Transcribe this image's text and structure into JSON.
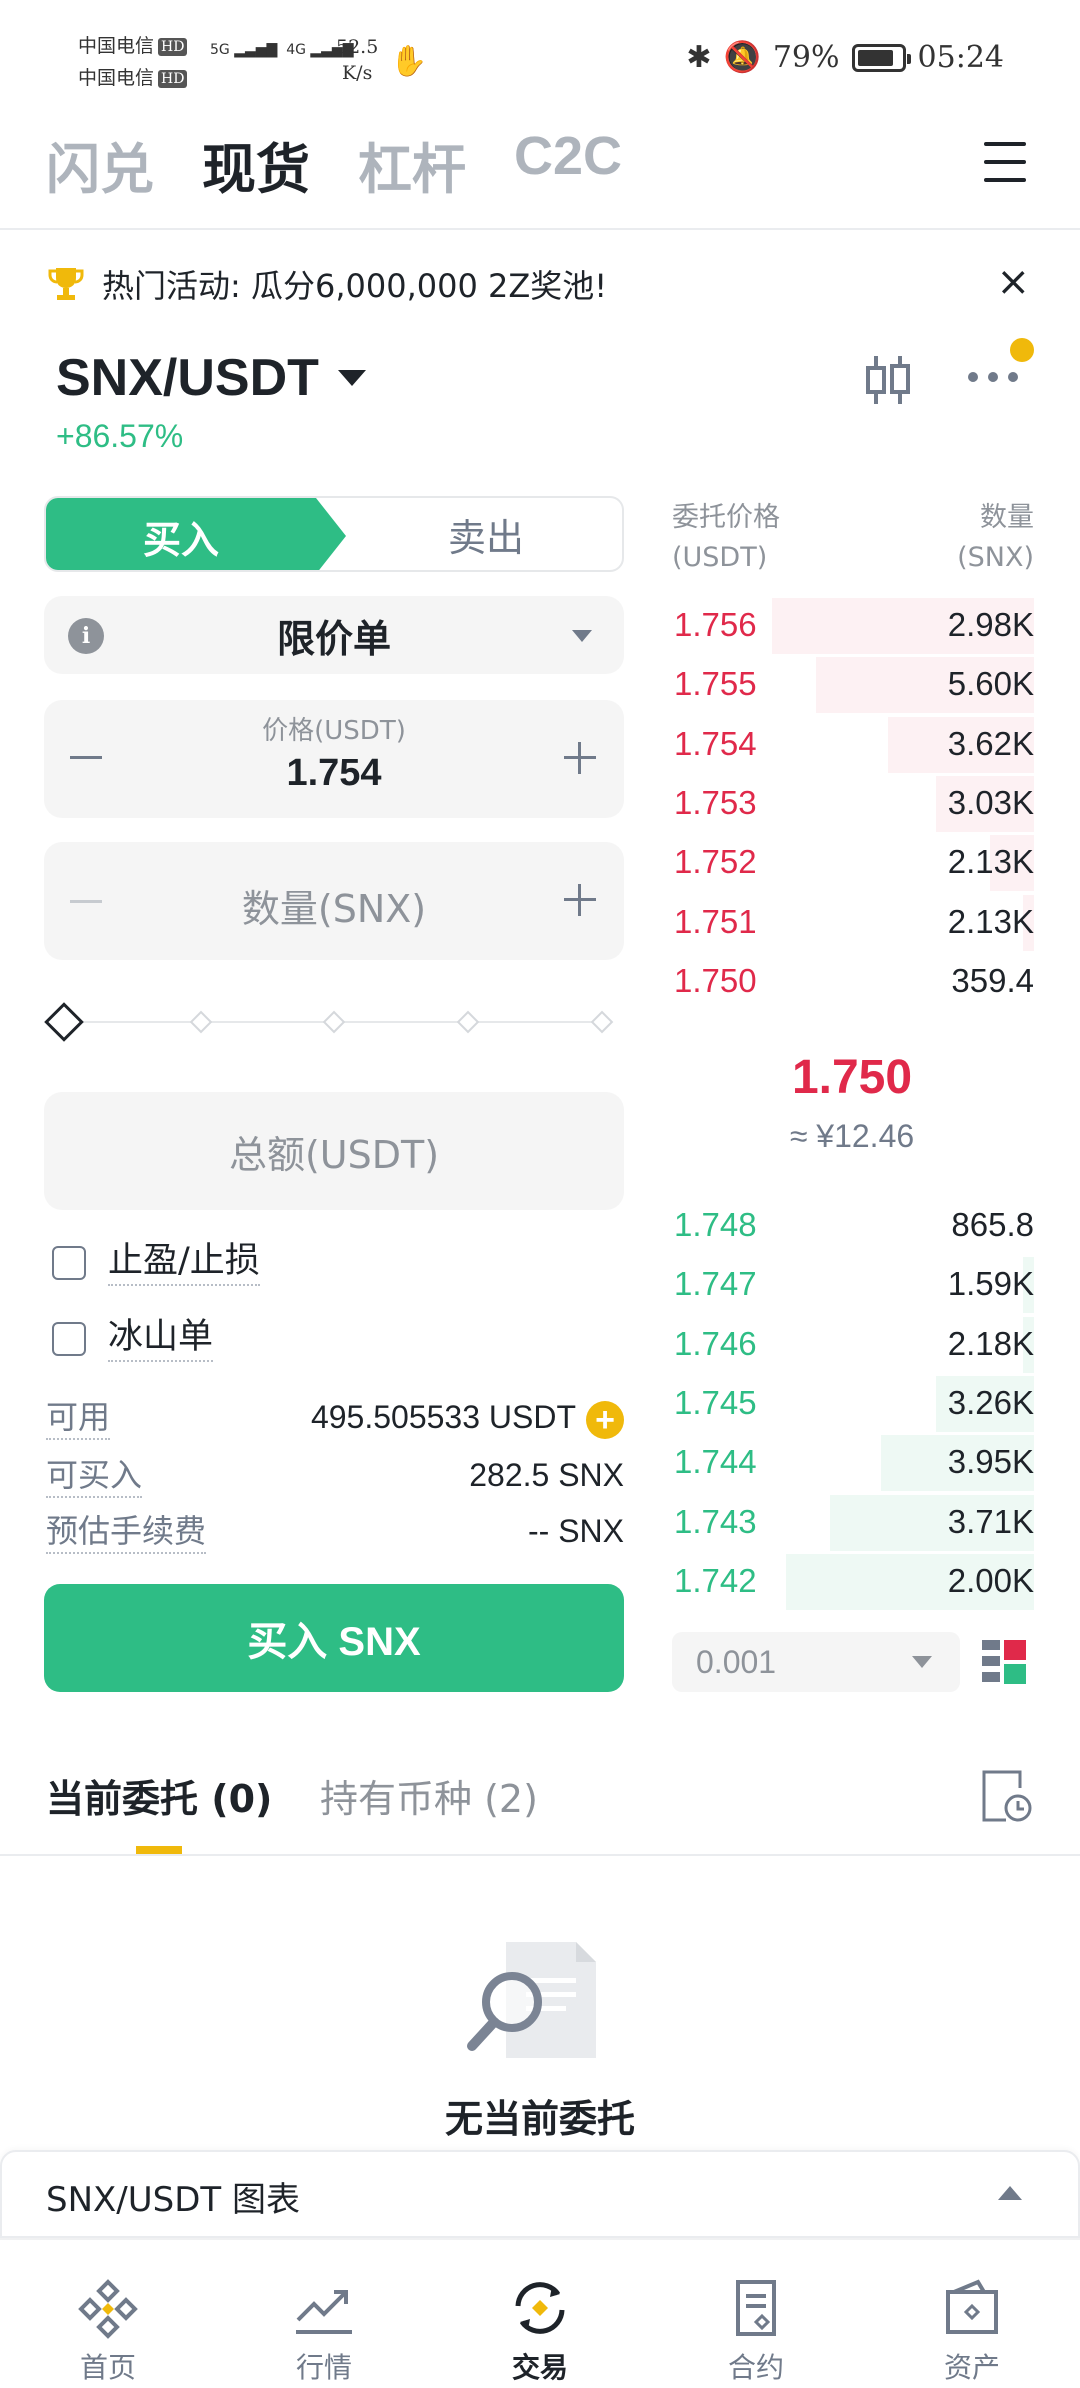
{
  "statusbar": {
    "carrier1": "中国电信",
    "carrier2": "中国电信",
    "hd": "HD",
    "net1": "5G",
    "net2": "4G",
    "speed_value": "52.5",
    "speed_unit": "K/s",
    "battery": "79%",
    "time": "05:24"
  },
  "top_tabs": [
    {
      "label": "闪兑",
      "active": false
    },
    {
      "label": "现货",
      "active": true
    },
    {
      "label": "杠杆",
      "active": false
    },
    {
      "label": "C2C",
      "active": false
    }
  ],
  "banner": {
    "text": "热门活动: 瓜分6,000,000 2Z奖池!",
    "close": "×"
  },
  "pair": {
    "symbol": "SNX/USDT",
    "change": "+86.57%"
  },
  "order_form": {
    "buy_label": "买入",
    "sell_label": "卖出",
    "order_type": "限价单",
    "price_label": "价格(USDT)",
    "price_value": "1.754",
    "qty_placeholder": "数量(SNX)",
    "total_placeholder": "总额(USDT)",
    "tpsl_label": "止盈/止损",
    "iceberg_label": "冰山单",
    "available_label": "可用",
    "available_value": "495.505533 USDT",
    "max_buy_label": "可买入",
    "max_buy_value": "282.5 SNX",
    "fee_label": "预估手续费",
    "fee_value": "-- SNX",
    "submit_label": "买入 SNX"
  },
  "orderbook": {
    "price_header_1": "委托价格",
    "price_header_2": "(USDT)",
    "qty_header_1": "数量",
    "qty_header_2": "(SNX)",
    "asks": [
      {
        "price": "1.756",
        "qty": "2.98K",
        "depth": 0.72
      },
      {
        "price": "1.755",
        "qty": "5.60K",
        "depth": 0.6
      },
      {
        "price": "1.754",
        "qty": "3.62K",
        "depth": 0.4
      },
      {
        "price": "1.753",
        "qty": "3.03K",
        "depth": 0.27
      },
      {
        "price": "1.752",
        "qty": "2.13K",
        "depth": 0.12
      },
      {
        "price": "1.751",
        "qty": "2.13K",
        "depth": 0.03
      },
      {
        "price": "1.750",
        "qty": "359.4",
        "depth": 0.0
      }
    ],
    "last_price": "1.750",
    "last_price_cny": "≈ ¥12.46",
    "bids": [
      {
        "price": "1.748",
        "qty": "865.8",
        "depth": 0.0
      },
      {
        "price": "1.747",
        "qty": "1.59K",
        "depth": 0.03
      },
      {
        "price": "1.746",
        "qty": "2.18K",
        "depth": 0.03
      },
      {
        "price": "1.745",
        "qty": "3.26K",
        "depth": 0.27
      },
      {
        "price": "1.744",
        "qty": "3.95K",
        "depth": 0.42
      },
      {
        "price": "1.743",
        "qty": "3.71K",
        "depth": 0.56
      },
      {
        "price": "1.742",
        "qty": "2.00K",
        "depth": 0.68
      }
    ],
    "precision": "0.001"
  },
  "orders": {
    "tab_open": "当前委托 (0)",
    "tab_holdings": "持有币种 (2)",
    "empty_text": "无当前委托"
  },
  "chart_panel": {
    "label": "SNX/USDT 图表"
  },
  "bottom_nav": [
    {
      "label": "首页",
      "icon": "home-icon",
      "active": false
    },
    {
      "label": "行情",
      "icon": "markets-icon",
      "active": false
    },
    {
      "label": "交易",
      "icon": "trade-icon",
      "active": true
    },
    {
      "label": "合约",
      "icon": "futures-icon",
      "active": false
    },
    {
      "label": "资产",
      "icon": "wallet-icon",
      "active": false
    }
  ],
  "colors": {
    "buy_green": "#2ebd85",
    "sell_red": "#e0294a",
    "accent_yellow": "#f0b90b"
  }
}
